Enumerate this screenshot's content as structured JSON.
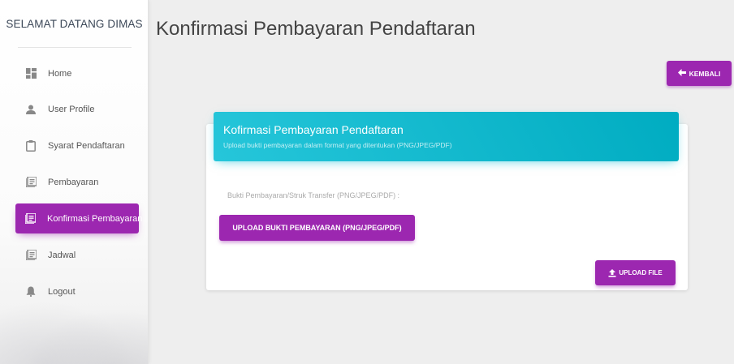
{
  "sidebar": {
    "brand": "SELAMAT DATANG DIMAS",
    "items": [
      {
        "label": "Home",
        "icon": "dashboard-icon"
      },
      {
        "label": "User Profile",
        "icon": "person-icon"
      },
      {
        "label": "Syarat Pendaftaran",
        "icon": "clipboard-icon"
      },
      {
        "label": "Pembayaran",
        "icon": "library-books-icon"
      },
      {
        "label": "Konfirmasi Pembayaran",
        "icon": "library-books-icon",
        "active": true
      },
      {
        "label": "Jadwal",
        "icon": "library-books-icon"
      },
      {
        "label": "Logout",
        "icon": "notifications-icon"
      }
    ]
  },
  "main": {
    "title": "Konfirmasi Pembayaran Pendaftaran",
    "back_label": "KEMBALI",
    "card": {
      "title": "Kofirmasi Pembayaran Pendaftaran",
      "subtitle": "Upload bukti pembayaran dalam format yang ditentukan (PNG/JPEG/PDF)",
      "field_label": "Bukti Pembayaran/Struk Transfer (PNG/JPEG/PDF) :",
      "upload_bukti_label": "UPLOAD BUKTI PEMBAYARAN (PNG/JPEG/PDF)",
      "upload_file_label": "UPLOAD FILE"
    }
  },
  "colors": {
    "accent": "#9c27b0",
    "header": "#00bcd4",
    "background": "#eeeeee"
  }
}
